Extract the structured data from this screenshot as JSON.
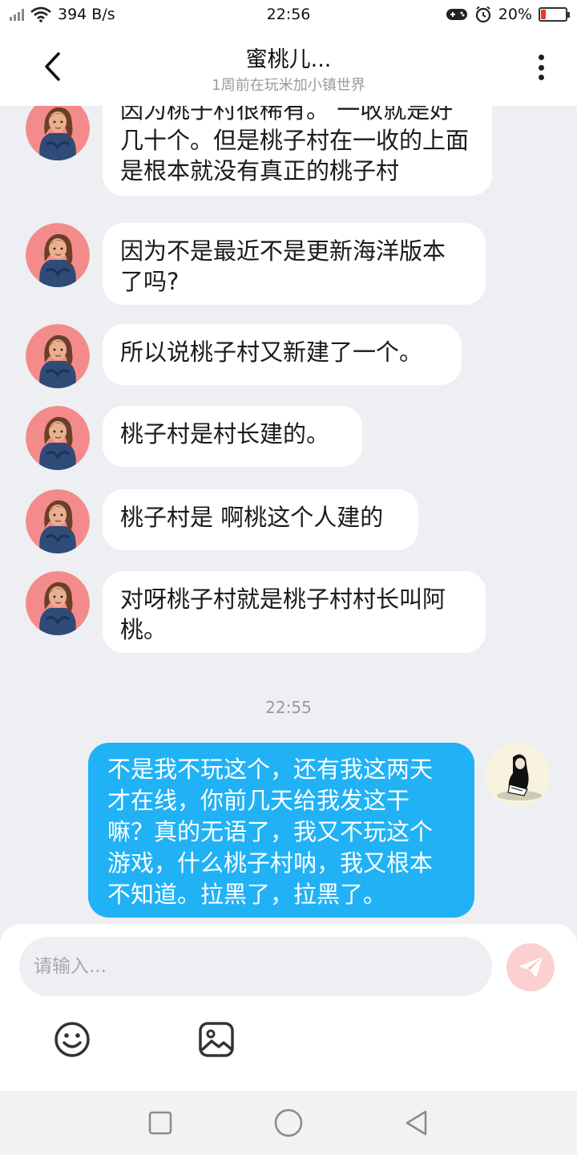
{
  "status_bar": {
    "network_speed": "394 B/s",
    "time": "22:56",
    "battery": "20%",
    "battery_level": 0.2
  },
  "header": {
    "title": "蜜桃儿...",
    "subtitle": "1周前在玩米加小镇世界"
  },
  "messages": [
    {
      "from": "other",
      "text": "因为桃子村很稀有。 一收就是好几十个。但是桃子村在一收的上面是根本就没有真正的桃子村"
    },
    {
      "from": "other",
      "text": "因为不是最近不是更新海洋版本了吗?"
    },
    {
      "from": "other",
      "text": "所以说桃子村又新建了一个。"
    },
    {
      "from": "other",
      "text": "桃子村是村长建的。"
    },
    {
      "from": "other",
      "text": "桃子村是 啊桃这个人建的"
    },
    {
      "from": "other",
      "text": "对呀桃子村就是桃子村村长叫阿桃。"
    },
    {
      "from": "me",
      "text": "不是我不玩这个，还有我这两天才在线，你前几天给我发这干嘛？真的无语了，我又不玩这个游戏，什么桃子村呐，我又根本不知道。拉黑了，拉黑了。"
    }
  ],
  "time_divider": "22:55",
  "composer": {
    "placeholder": "请输入..."
  },
  "icons": {
    "back": "back-arrow-icon",
    "more": "more-vertical-icon",
    "send": "send-icon",
    "emoji": "emoji-icon",
    "image": "image-icon"
  },
  "colors": {
    "my_bubble": "#20b2f5",
    "other_bubble": "#ffffff",
    "background": "#eeeff3",
    "send_button": "#fbd0d0",
    "battery_low": "#e53935"
  }
}
